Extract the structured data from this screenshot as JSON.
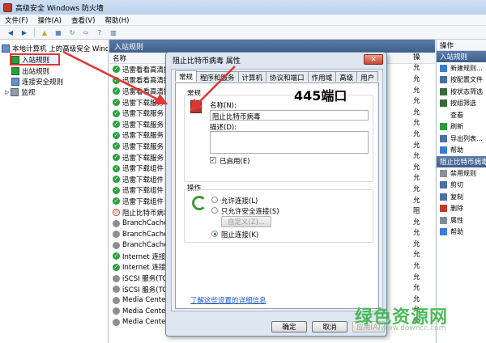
{
  "window": {
    "title": "高级安全 Windows 防火墙"
  },
  "menu": [
    "文件(F)",
    "操作(A)",
    "查看(V)",
    "帮助(H)"
  ],
  "tree": {
    "root": "本地计算机 上的高级安全 Wind",
    "items": [
      "入站规则",
      "出站规则",
      "连接安全规则",
      "监视"
    ]
  },
  "list": {
    "header": "入站规则",
    "column": "名称",
    "rows": [
      {
        "name": "迅雷看看高清播",
        "state": "green"
      },
      {
        "name": "迅雷看看高清播",
        "state": "green"
      },
      {
        "name": "迅雷看看高清播",
        "state": "green"
      },
      {
        "name": "迅雷下载服务",
        "state": "green"
      },
      {
        "name": "迅雷下载服务",
        "state": "green"
      },
      {
        "name": "迅雷下载服务",
        "state": "green"
      },
      {
        "name": "迅雷下载服务",
        "state": "green"
      },
      {
        "name": "迅雷下载服务",
        "state": "green"
      },
      {
        "name": "迅雷下载服务",
        "state": "green"
      },
      {
        "name": "迅雷下载组件",
        "state": "green"
      },
      {
        "name": "迅雷下载组件",
        "state": "green"
      },
      {
        "name": "迅雷下载组件",
        "state": "green"
      },
      {
        "name": "迅雷下载组件",
        "state": "green"
      },
      {
        "name": "阻止比特币病毒",
        "state": "block"
      },
      {
        "name": "BranchCache",
        "state": "grey"
      },
      {
        "name": "BranchCache",
        "state": "grey"
      },
      {
        "name": "BranchCache",
        "state": "grey"
      },
      {
        "name": "Internet 连接共",
        "state": "green"
      },
      {
        "name": "Internet 连接共",
        "state": "green"
      },
      {
        "name": "iSCSI 服务(TCP",
        "state": "grey"
      },
      {
        "name": "iSCSI 服务(TCP",
        "state": "grey"
      },
      {
        "name": "Media Center",
        "state": "grey"
      },
      {
        "name": "Media Center",
        "state": "grey"
      },
      {
        "name": "Media Center Extender - qWave (UDP-In)  Media Center Extender",
        "state": "grey"
      }
    ],
    "right_column": [
      "允",
      "允",
      "允",
      "允",
      "允",
      "允",
      "允",
      "允",
      "允",
      "允",
      "允",
      "允",
      "允",
      "阻",
      "允",
      "允",
      "允",
      "允",
      "允",
      "允",
      "允",
      "允",
      "允",
      "允"
    ],
    "right_header": "操"
  },
  "actions": {
    "header": "操作",
    "section1": "入站规则",
    "items1": [
      "新建规则...",
      "按配置文件",
      "按状态筛选",
      "按组筛选",
      "查看",
      "刷新",
      "导出列表...",
      "帮助"
    ],
    "section2": "阻止比特币病毒",
    "items2": [
      "禁用规则",
      "剪切",
      "复制",
      "删除",
      "属性",
      "帮助"
    ]
  },
  "dialog": {
    "title": "阻止比特币病毒 属性",
    "close": "✕",
    "tabs": [
      "常规",
      "程序和服务",
      "计算机",
      "协议和端口",
      "作用域",
      "高级",
      "用户"
    ],
    "general_group": "常规",
    "name_label": "名称(N):",
    "name_value": "阻止比特币病毒",
    "desc_label": "描述(D):",
    "desc_value": "",
    "enabled_label": "已启用(E)",
    "enabled": true,
    "action_group": "操作",
    "options": [
      "允许连接(L)",
      "只允许安全连接(S)",
      "阻止连接(K)"
    ],
    "selected_option": 2,
    "custom_button": "自定义(Z)...",
    "link": "了解这些设置的详细信息",
    "buttons": {
      "ok": "确定",
      "cancel": "取消",
      "apply": "应用(A)"
    },
    "annotation": "445端口"
  },
  "watermark": {
    "text": "绿色资源网",
    "url": "www.downcc.com"
  },
  "colors": {
    "arrow": "#e23636",
    "accent": "#3e5f8c",
    "watermark": "#3bb54a"
  }
}
